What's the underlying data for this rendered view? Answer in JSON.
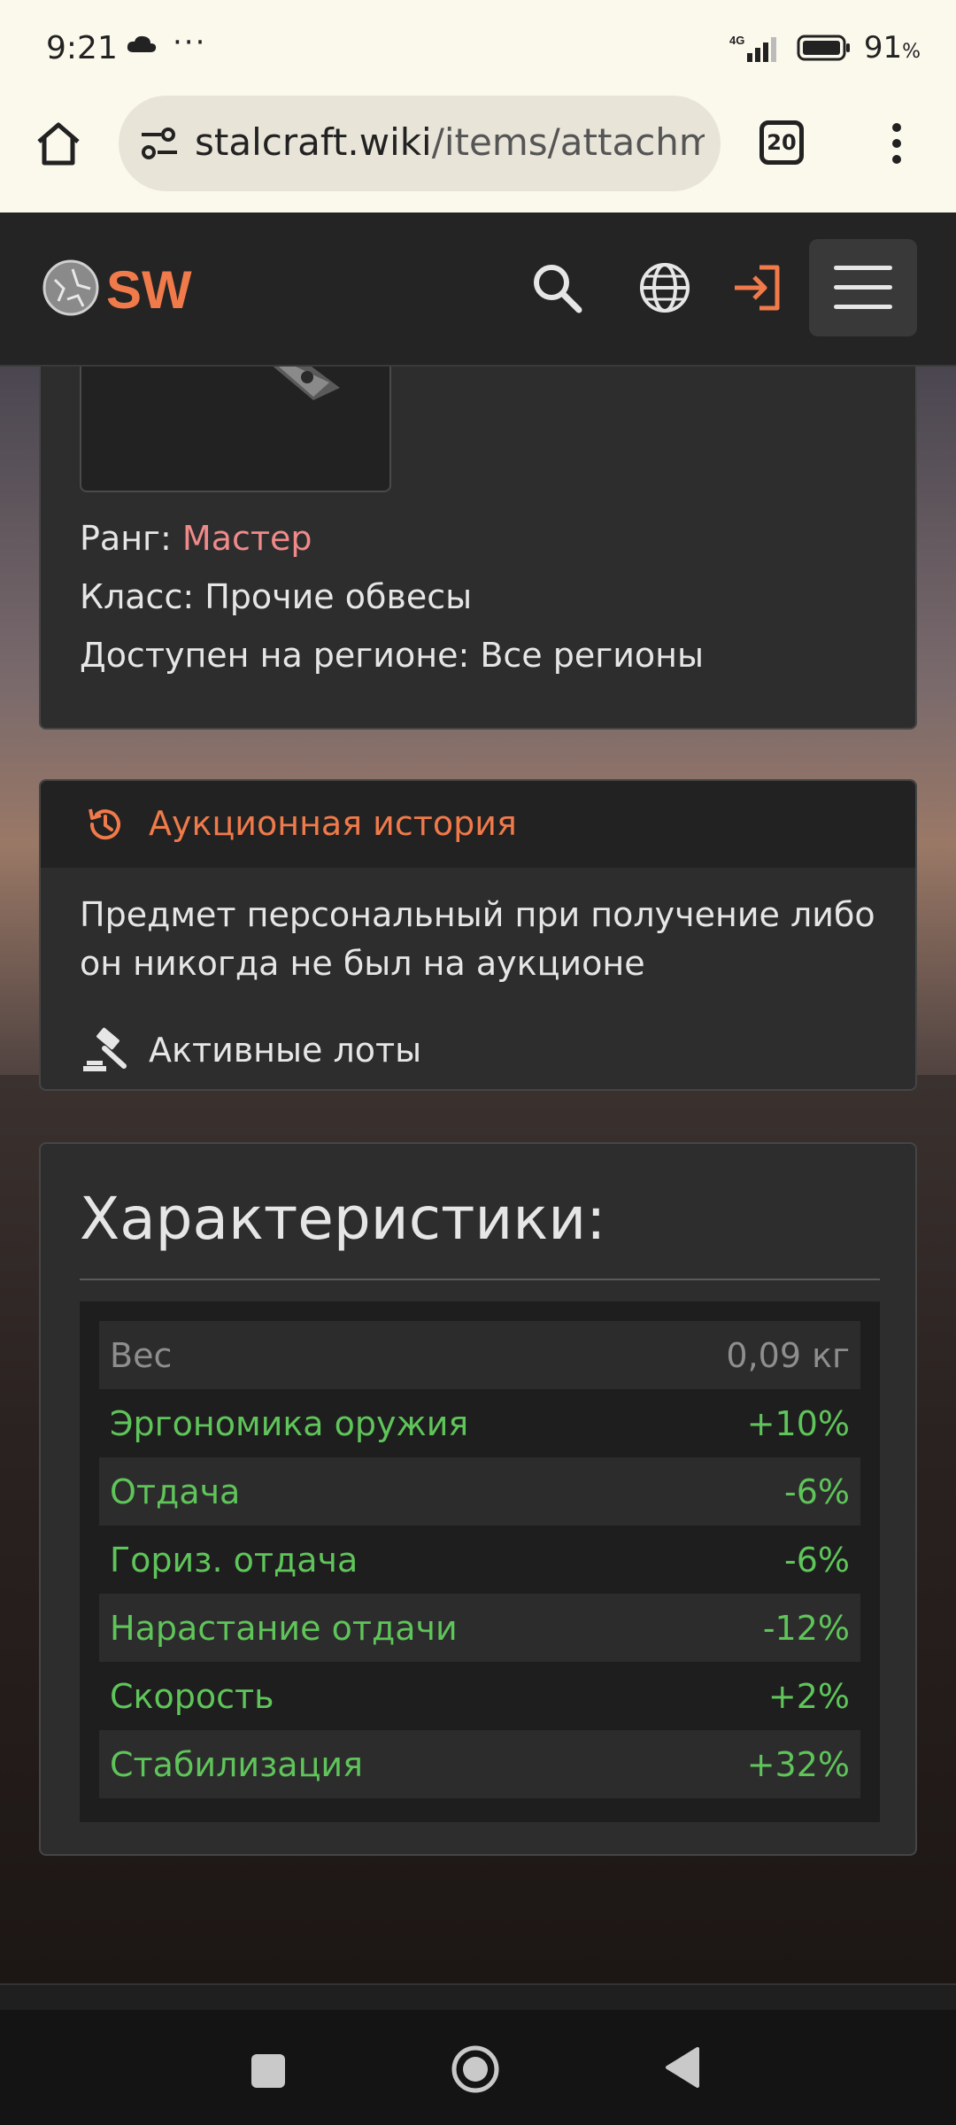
{
  "status_bar": {
    "time": "9:21",
    "dots": "···",
    "network": "4G",
    "battery_percent": "91",
    "battery_unit": "%"
  },
  "browser": {
    "url_domain": "stalcraft.wiki",
    "url_path": "/items/attachmen",
    "tab_count": "20"
  },
  "header": {
    "logo_text": "SW"
  },
  "item_info": {
    "rank_label": "Ранг: ",
    "rank_value": "Мастер",
    "class_line": "Класс: Прочие обвесы",
    "region_line": "Доступен на регионе: Все регионы"
  },
  "auction": {
    "title": "Аукционная история",
    "message": "Предмет персональный при получение либо он никогда не был на аукционе",
    "active_lots": "Активные лоты"
  },
  "specs": {
    "title": "Характеристики:",
    "rows": [
      {
        "label": "Вес",
        "value": "0,09 кг"
      },
      {
        "label": "Эргономика оружия",
        "value": "+10%"
      },
      {
        "label": "Отдача",
        "value": "-6%"
      },
      {
        "label": "Гориз. отдача",
        "value": "-6%"
      },
      {
        "label": "Нарастание отдачи",
        "value": "-12%"
      },
      {
        "label": "Скорость",
        "value": "+2%"
      },
      {
        "label": "Стабилизация",
        "value": "+32%"
      }
    ]
  },
  "colors": {
    "accent": "#f07a4a",
    "rank": "#f08a8a",
    "positive": "#5fc45a",
    "muted": "#8e8e8e"
  }
}
